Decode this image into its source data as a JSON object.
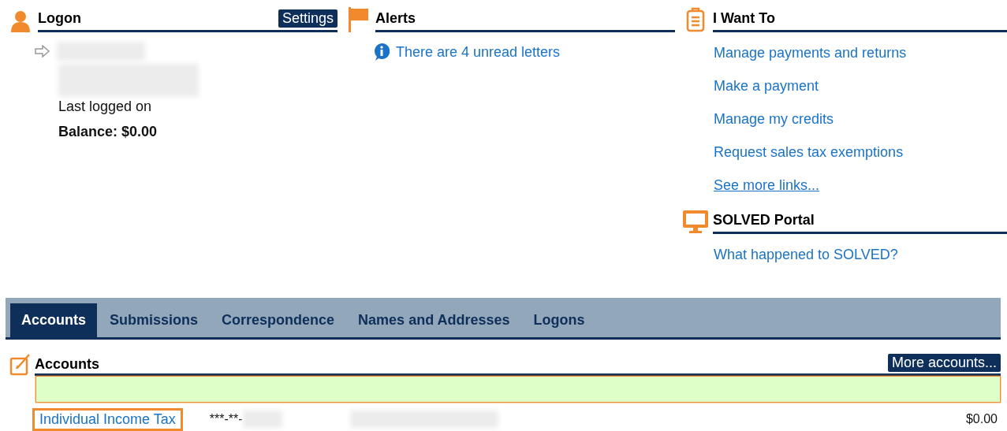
{
  "logon": {
    "title": "Logon",
    "settings_button": "Settings",
    "last_logged_on": "Last logged on",
    "balance": "Balance: $0.00"
  },
  "alerts": {
    "title": "Alerts",
    "items": [
      "There are 4 unread letters"
    ]
  },
  "i_want_to": {
    "title": "I Want To",
    "links": [
      {
        "label": "Manage payments and returns",
        "underlined": false
      },
      {
        "label": "Make a payment",
        "underlined": false
      },
      {
        "label": "Manage my credits",
        "underlined": false
      },
      {
        "label": "Request sales tax exemptions",
        "underlined": false
      },
      {
        "label": "See more links...",
        "underlined": true
      }
    ]
  },
  "solved_portal": {
    "title": "SOLVED Portal",
    "links": [
      "What happened to SOLVED?"
    ]
  },
  "tabs": [
    {
      "label": "Accounts",
      "selected": true
    },
    {
      "label": "Submissions",
      "selected": false
    },
    {
      "label": "Correspondence",
      "selected": false
    },
    {
      "label": "Names and Addresses",
      "selected": false
    },
    {
      "label": "Logons",
      "selected": false
    }
  ],
  "accounts": {
    "title": "Accounts",
    "more_button": "More accounts...",
    "filter": {
      "focused": true
    },
    "rows": [
      {
        "name": "Individual Income Tax",
        "id": "***-**-",
        "balance": "$0.00",
        "focused": true
      }
    ]
  }
}
